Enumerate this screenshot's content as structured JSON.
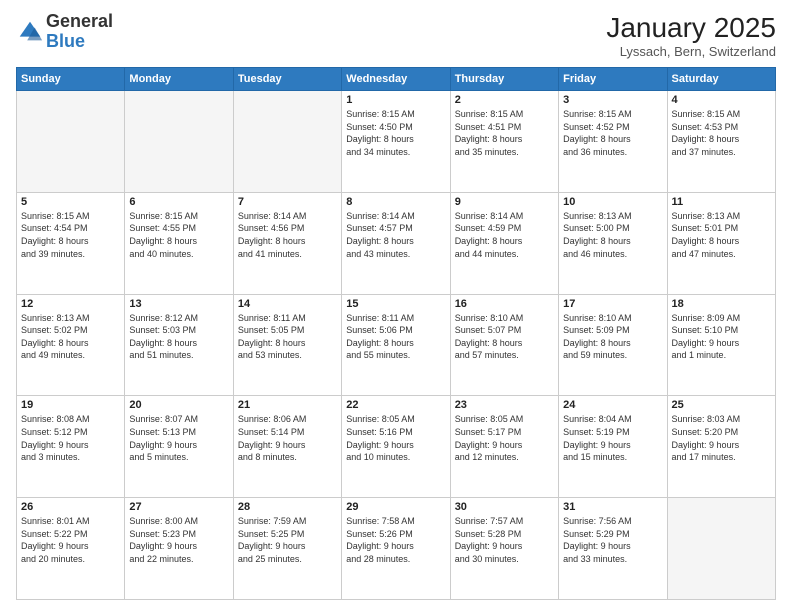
{
  "header": {
    "logo_line1": "General",
    "logo_line2": "Blue",
    "month": "January 2025",
    "location": "Lyssach, Bern, Switzerland"
  },
  "weekdays": [
    "Sunday",
    "Monday",
    "Tuesday",
    "Wednesday",
    "Thursday",
    "Friday",
    "Saturday"
  ],
  "weeks": [
    [
      {
        "day": "",
        "info": ""
      },
      {
        "day": "",
        "info": ""
      },
      {
        "day": "",
        "info": ""
      },
      {
        "day": "1",
        "info": "Sunrise: 8:15 AM\nSunset: 4:50 PM\nDaylight: 8 hours\nand 34 minutes."
      },
      {
        "day": "2",
        "info": "Sunrise: 8:15 AM\nSunset: 4:51 PM\nDaylight: 8 hours\nand 35 minutes."
      },
      {
        "day": "3",
        "info": "Sunrise: 8:15 AM\nSunset: 4:52 PM\nDaylight: 8 hours\nand 36 minutes."
      },
      {
        "day": "4",
        "info": "Sunrise: 8:15 AM\nSunset: 4:53 PM\nDaylight: 8 hours\nand 37 minutes."
      }
    ],
    [
      {
        "day": "5",
        "info": "Sunrise: 8:15 AM\nSunset: 4:54 PM\nDaylight: 8 hours\nand 39 minutes."
      },
      {
        "day": "6",
        "info": "Sunrise: 8:15 AM\nSunset: 4:55 PM\nDaylight: 8 hours\nand 40 minutes."
      },
      {
        "day": "7",
        "info": "Sunrise: 8:14 AM\nSunset: 4:56 PM\nDaylight: 8 hours\nand 41 minutes."
      },
      {
        "day": "8",
        "info": "Sunrise: 8:14 AM\nSunset: 4:57 PM\nDaylight: 8 hours\nand 43 minutes."
      },
      {
        "day": "9",
        "info": "Sunrise: 8:14 AM\nSunset: 4:59 PM\nDaylight: 8 hours\nand 44 minutes."
      },
      {
        "day": "10",
        "info": "Sunrise: 8:13 AM\nSunset: 5:00 PM\nDaylight: 8 hours\nand 46 minutes."
      },
      {
        "day": "11",
        "info": "Sunrise: 8:13 AM\nSunset: 5:01 PM\nDaylight: 8 hours\nand 47 minutes."
      }
    ],
    [
      {
        "day": "12",
        "info": "Sunrise: 8:13 AM\nSunset: 5:02 PM\nDaylight: 8 hours\nand 49 minutes."
      },
      {
        "day": "13",
        "info": "Sunrise: 8:12 AM\nSunset: 5:03 PM\nDaylight: 8 hours\nand 51 minutes."
      },
      {
        "day": "14",
        "info": "Sunrise: 8:11 AM\nSunset: 5:05 PM\nDaylight: 8 hours\nand 53 minutes."
      },
      {
        "day": "15",
        "info": "Sunrise: 8:11 AM\nSunset: 5:06 PM\nDaylight: 8 hours\nand 55 minutes."
      },
      {
        "day": "16",
        "info": "Sunrise: 8:10 AM\nSunset: 5:07 PM\nDaylight: 8 hours\nand 57 minutes."
      },
      {
        "day": "17",
        "info": "Sunrise: 8:10 AM\nSunset: 5:09 PM\nDaylight: 8 hours\nand 59 minutes."
      },
      {
        "day": "18",
        "info": "Sunrise: 8:09 AM\nSunset: 5:10 PM\nDaylight: 9 hours\nand 1 minute."
      }
    ],
    [
      {
        "day": "19",
        "info": "Sunrise: 8:08 AM\nSunset: 5:12 PM\nDaylight: 9 hours\nand 3 minutes."
      },
      {
        "day": "20",
        "info": "Sunrise: 8:07 AM\nSunset: 5:13 PM\nDaylight: 9 hours\nand 5 minutes."
      },
      {
        "day": "21",
        "info": "Sunrise: 8:06 AM\nSunset: 5:14 PM\nDaylight: 9 hours\nand 8 minutes."
      },
      {
        "day": "22",
        "info": "Sunrise: 8:05 AM\nSunset: 5:16 PM\nDaylight: 9 hours\nand 10 minutes."
      },
      {
        "day": "23",
        "info": "Sunrise: 8:05 AM\nSunset: 5:17 PM\nDaylight: 9 hours\nand 12 minutes."
      },
      {
        "day": "24",
        "info": "Sunrise: 8:04 AM\nSunset: 5:19 PM\nDaylight: 9 hours\nand 15 minutes."
      },
      {
        "day": "25",
        "info": "Sunrise: 8:03 AM\nSunset: 5:20 PM\nDaylight: 9 hours\nand 17 minutes."
      }
    ],
    [
      {
        "day": "26",
        "info": "Sunrise: 8:01 AM\nSunset: 5:22 PM\nDaylight: 9 hours\nand 20 minutes."
      },
      {
        "day": "27",
        "info": "Sunrise: 8:00 AM\nSunset: 5:23 PM\nDaylight: 9 hours\nand 22 minutes."
      },
      {
        "day": "28",
        "info": "Sunrise: 7:59 AM\nSunset: 5:25 PM\nDaylight: 9 hours\nand 25 minutes."
      },
      {
        "day": "29",
        "info": "Sunrise: 7:58 AM\nSunset: 5:26 PM\nDaylight: 9 hours\nand 28 minutes."
      },
      {
        "day": "30",
        "info": "Sunrise: 7:57 AM\nSunset: 5:28 PM\nDaylight: 9 hours\nand 30 minutes."
      },
      {
        "day": "31",
        "info": "Sunrise: 7:56 AM\nSunset: 5:29 PM\nDaylight: 9 hours\nand 33 minutes."
      },
      {
        "day": "",
        "info": ""
      }
    ]
  ]
}
